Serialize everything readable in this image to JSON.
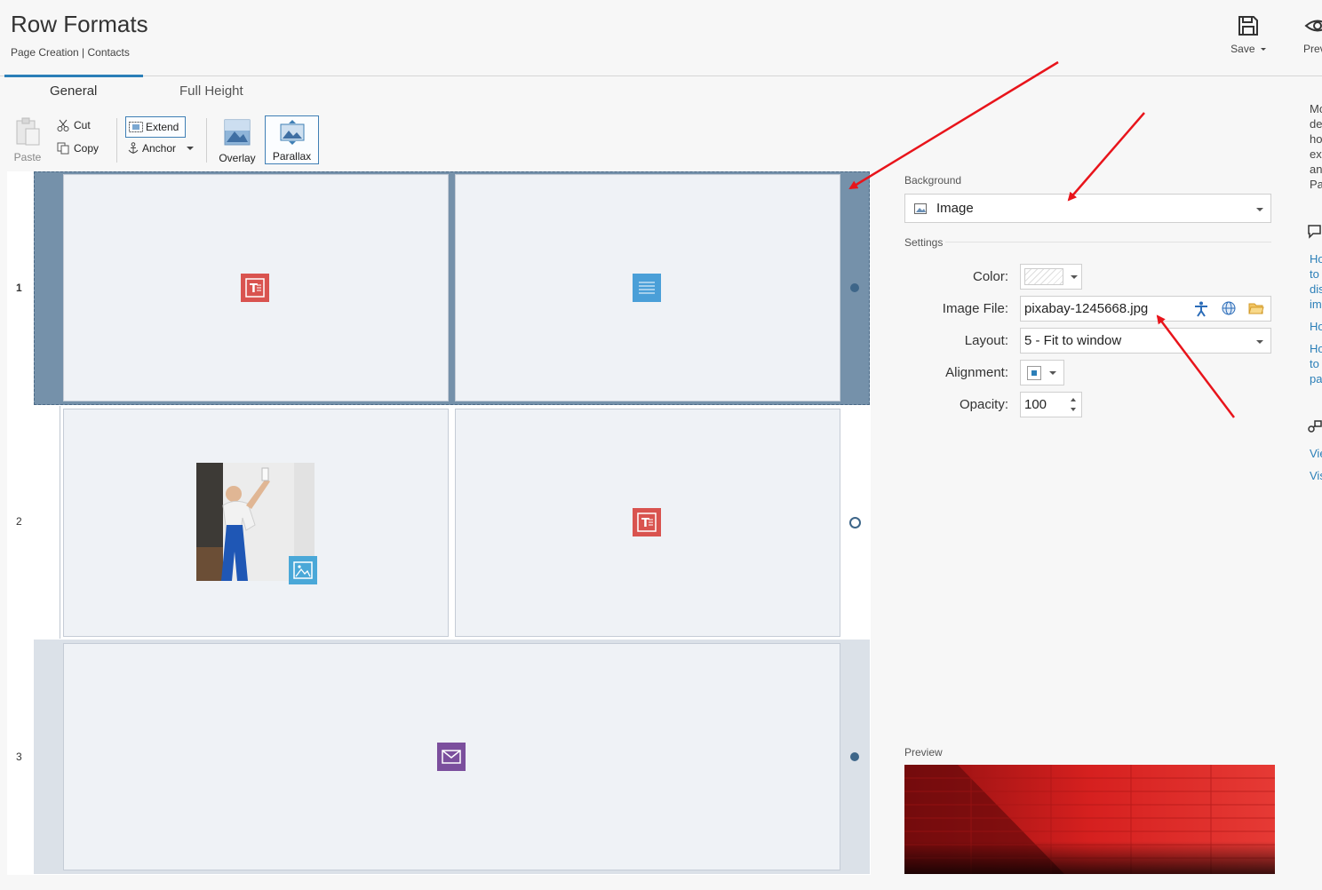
{
  "header": {
    "title": "Row Formats",
    "breadcrumb": "Page Creation | Contacts",
    "save_label": "Save",
    "preview_label": "Prev"
  },
  "tabs": [
    {
      "label": "General",
      "active": true
    },
    {
      "label": "Full Height",
      "active": false
    }
  ],
  "ribbon": {
    "paste": "Paste",
    "cut": "Cut",
    "copy": "Copy",
    "extend": "Extend",
    "anchor": "Anchor",
    "overlay": "Overlay",
    "parallax": "Parallax"
  },
  "grid": {
    "rows": [
      {
        "number": "1",
        "selected": true,
        "cells": [
          "text-block-icon",
          "paragraph-icon"
        ],
        "marker": "filled"
      },
      {
        "number": "2",
        "selected": false,
        "cells": [
          "image-block",
          "text-block-icon"
        ],
        "marker": "empty"
      },
      {
        "number": "3",
        "selected": false,
        "cells": [
          "mail-icon"
        ],
        "marker": "filled"
      }
    ]
  },
  "settings": {
    "background_label": "Background",
    "background_value": "Image",
    "settings_label": "Settings",
    "color_label": "Color:",
    "image_file_label": "Image File:",
    "image_file_value": "pixabay-1245668.jpg",
    "layout_label": "Layout:",
    "layout_value": "5 - Fit to window",
    "alignment_label": "Alignment:",
    "opacity_label": "Opacity:",
    "opacity_value": "100",
    "preview_label": "Preview"
  },
  "help": {
    "text_lines": [
      "Mo",
      "de",
      "ho",
      "ex",
      "an",
      "Pa"
    ],
    "links_a": [
      "Ho",
      "to",
      "dis",
      "im"
    ],
    "link_b": "Ho",
    "links_c": [
      "Ho",
      "to",
      "pa"
    ],
    "links_d": [
      "Vie",
      "Vis"
    ]
  },
  "colors": {
    "accent": "#2b7fb8",
    "selected_row": "#7591aa",
    "text_icon": "#d9534f",
    "paragraph_icon": "#4a9fd8",
    "mail_icon": "#7b4f9d",
    "arrow": "#e8141b"
  }
}
